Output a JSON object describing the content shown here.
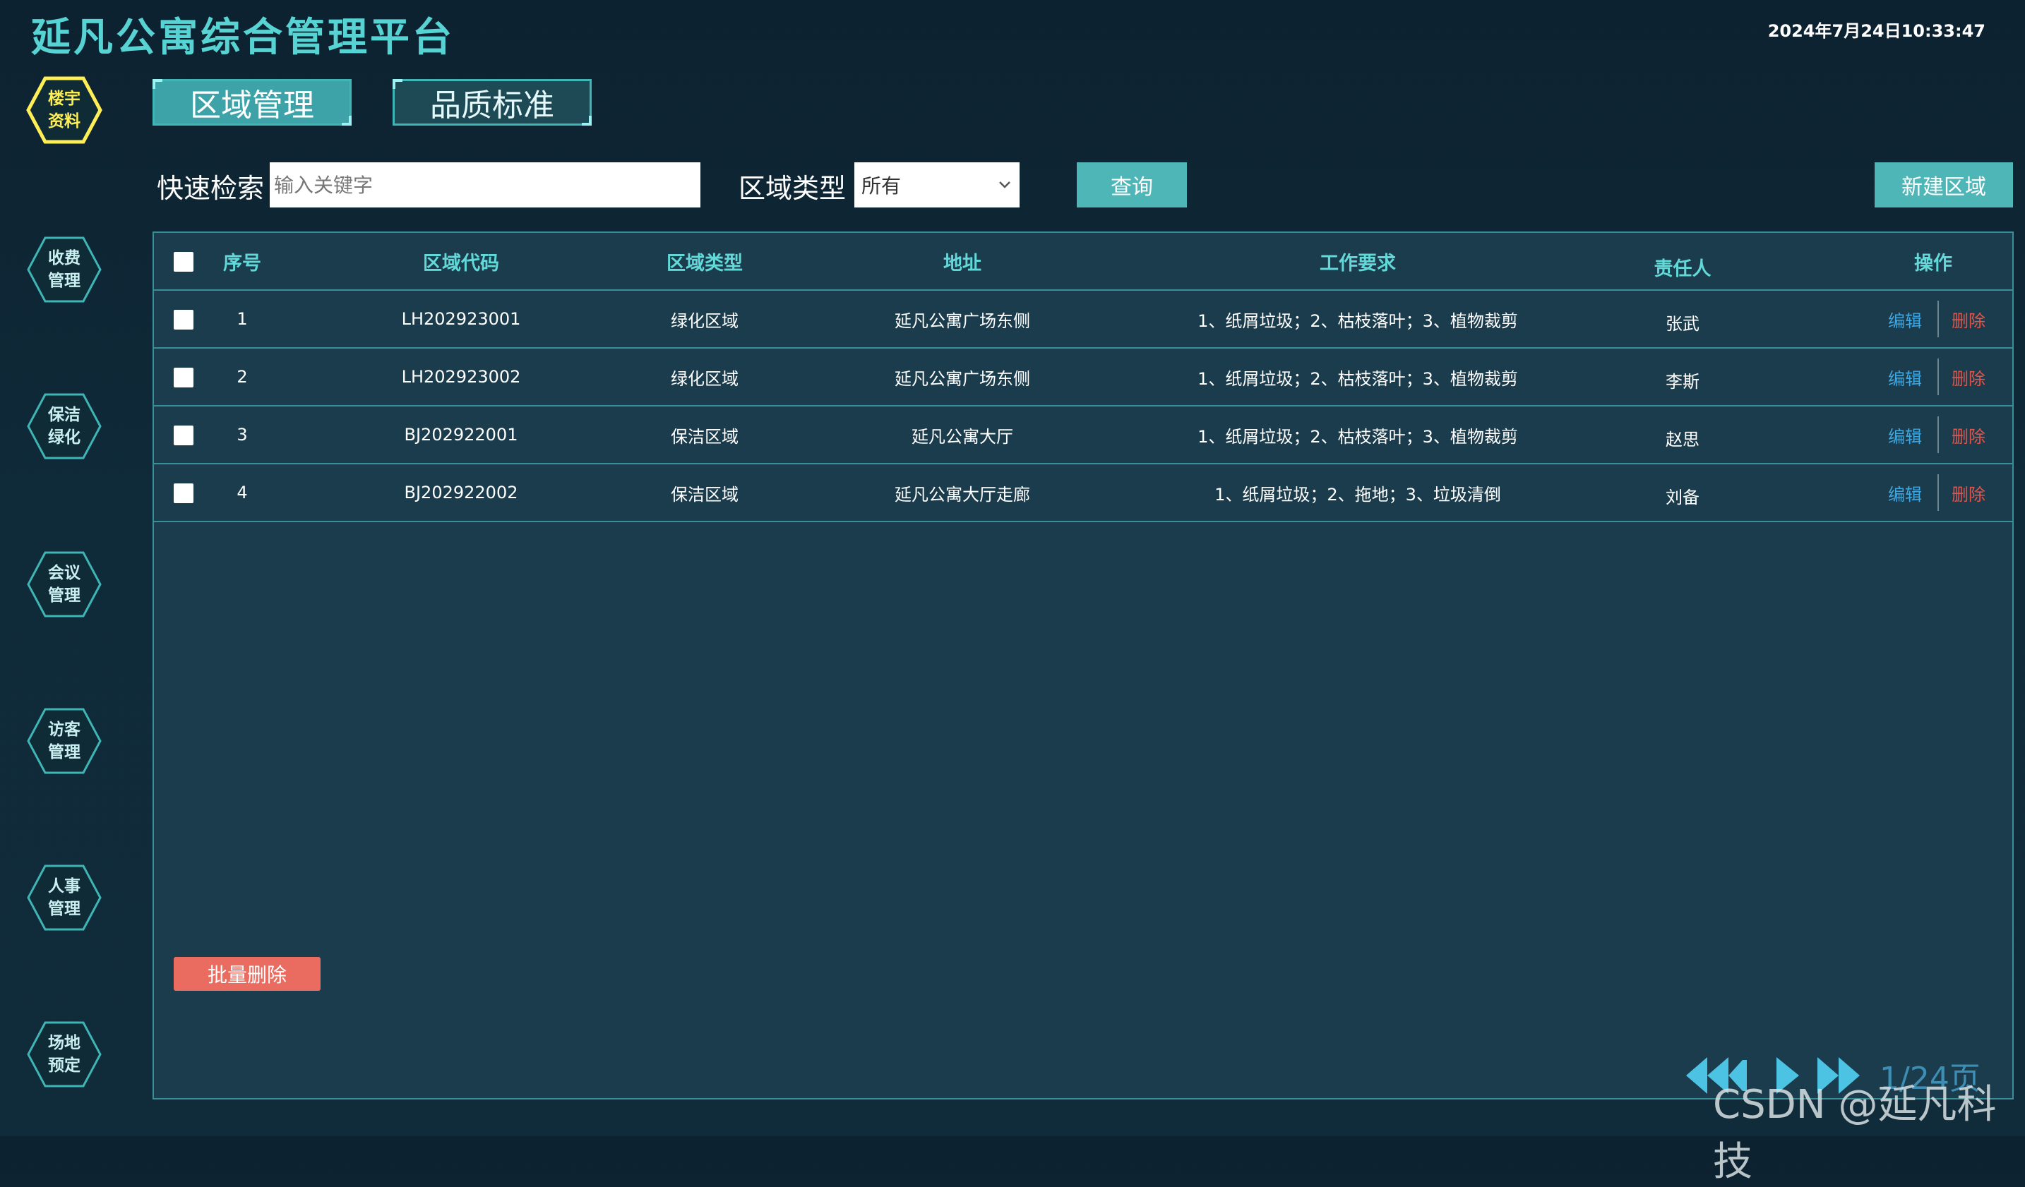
{
  "header": {
    "app_title": "延凡公寓综合管理平台",
    "datetime": "2024年7月24日10:33:47"
  },
  "sidebar": {
    "items": [
      {
        "line1": "楼宇",
        "line2": "资料",
        "active": true,
        "icon": "hexagon-icon"
      },
      {
        "line1": "收费",
        "line2": "管理",
        "active": false,
        "icon": "hexagon-icon"
      },
      {
        "line1": "保洁",
        "line2": "绿化",
        "active": false,
        "icon": "hexagon-icon"
      },
      {
        "line1": "会议",
        "line2": "管理",
        "active": false,
        "icon": "hexagon-icon"
      },
      {
        "line1": "访客",
        "line2": "管理",
        "active": false,
        "icon": "hexagon-icon"
      },
      {
        "line1": "人事",
        "line2": "管理",
        "active": false,
        "icon": "hexagon-icon"
      },
      {
        "line1": "场地",
        "line2": "预定",
        "active": false,
        "icon": "hexagon-icon"
      }
    ]
  },
  "tabs": [
    {
      "label": "区域管理",
      "active": true
    },
    {
      "label": "品质标准",
      "active": false
    }
  ],
  "search": {
    "label": "快速检索",
    "placeholder": "输入关键字",
    "value": "",
    "type_label": "区域类型",
    "type_selected": "所有",
    "query_button": "查询",
    "new_button": "新建区域"
  },
  "table": {
    "headers": {
      "index": "序号",
      "code": "区域代码",
      "type": "区域类型",
      "address": "地址",
      "requirement": "工作要求",
      "owner": "责任人",
      "actions": "操作"
    },
    "rows": [
      {
        "index": "1",
        "code": "LH202923001",
        "type": "绿化区域",
        "address": "延凡公寓广场东侧",
        "requirement": "1、纸屑垃圾；2、枯枝落叶；3、植物裁剪",
        "owner": "张武",
        "edit": "编辑",
        "delete": "删除"
      },
      {
        "index": "2",
        "code": "LH202923002",
        "type": "绿化区域",
        "address": "延凡公寓广场东侧",
        "requirement": "1、纸屑垃圾；2、枯枝落叶；3、植物裁剪",
        "owner": "李斯",
        "edit": "编辑",
        "delete": "删除"
      },
      {
        "index": "3",
        "code": "BJ202922001",
        "type": "保洁区域",
        "address": "延凡公寓大厅",
        "requirement": "1、纸屑垃圾；2、枯枝落叶；3、植物裁剪",
        "owner": "赵思",
        "edit": "编辑",
        "delete": "删除"
      },
      {
        "index": "4",
        "code": "BJ202922002",
        "type": "保洁区域",
        "address": "延凡公寓大厅走廊",
        "requirement": "1、纸屑垃圾；2、拖地；3、垃圾清倒",
        "owner": "刘备",
        "edit": "编辑",
        "delete": "删除"
      }
    ],
    "batch_delete": "批量删除"
  },
  "pagination": {
    "text": "1/24页",
    "icons": [
      "first-page-icon",
      "prev-page-icon",
      "next-page-icon",
      "last-page-icon"
    ]
  },
  "watermark": "CSDN @延凡科技",
  "colors": {
    "accent": "#56d3d2",
    "active_sidebar": "#ffef56",
    "button": "#4fb6b7",
    "danger": "#ea6b5f",
    "edit_link": "#3fa6e0",
    "delete_link": "#e55349"
  }
}
